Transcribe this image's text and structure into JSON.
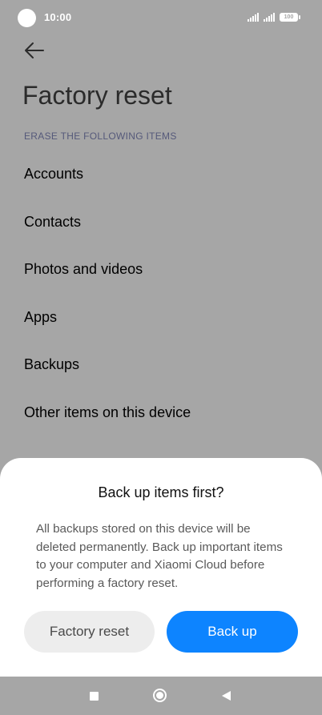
{
  "status_bar": {
    "time": "10:00",
    "battery": "100"
  },
  "header": {
    "title": "Factory reset",
    "section_label": "ERASE THE FOLLOWING ITEMS"
  },
  "items": [
    "Accounts",
    "Contacts",
    "Photos and videos",
    "Apps",
    "Backups",
    "Other items on this device"
  ],
  "dialog": {
    "title": "Back up items first?",
    "message": "All backups stored on this device will be deleted permanently. Back up important items to your computer and Xiaomi Cloud before performing a factory reset.",
    "secondary_button": "Factory reset",
    "primary_button": "Back up"
  },
  "colors": {
    "scrim": "#a6a6a6",
    "accent": "#0d84ff",
    "secondary_button": "#ededed"
  },
  "icons": [
    "back-arrow-icon",
    "signal-icon",
    "battery-icon",
    "recents-icon",
    "home-icon",
    "back-icon"
  ]
}
